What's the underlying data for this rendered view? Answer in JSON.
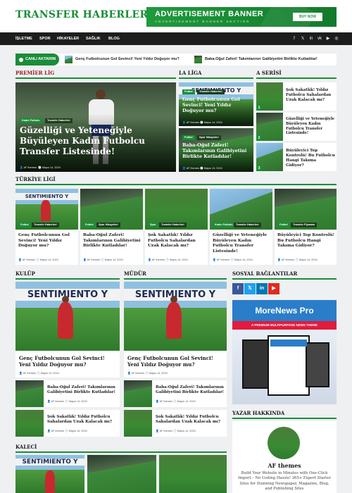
{
  "header": {
    "logo": "TRANSFER HABERLERİ",
    "ad_title": "ADVERTISEMENT BANNER",
    "ad_subtitle": "ADVERTISEMENT BANNER SECTION",
    "ad_button": "BUY NOW"
  },
  "nav": {
    "items": [
      "İŞLETME",
      "SPOR",
      "HİKAYELER",
      "SAĞLIK",
      "BLOG"
    ],
    "social_icons": [
      "facebook-icon",
      "x-icon",
      "linkedin-icon",
      "vk-icon",
      "youtube-icon",
      "instagram-icon"
    ],
    "social_glyphs": [
      "f",
      "𝕏",
      "in",
      "vk",
      "▶",
      "◎"
    ]
  },
  "ticker": {
    "label": "CANLI AKTARIM",
    "items": [
      "Genç Futbolcunun Gol Sevinci! Yeni Yıldız Doğuyor mu?",
      "Baba-Oğul Zaferi! Takımlarının Galibiyetini Birlikte Kutladılar!"
    ]
  },
  "sections": {
    "premier": "PREMİER LİG",
    "laliga": "LA LİGA",
    "serie": "A SERİSİ",
    "turkiye": "TÜRKİYE LİGİ",
    "kulup": "KULÜP",
    "mudur": "MÜDÜR",
    "sosyal": "SOSYAL BAĞLANTILAR",
    "yazar": "YAZAR HAKKINDA",
    "kaleci": "KALECİ"
  },
  "premier": {
    "tags": [
      "Kadın Futbolu",
      "Transfer Haberleri"
    ],
    "title": "Güzelliği ve Yeteneğiyle Büyüleyen Kadın Futbolcu Transfer Listesinde!",
    "author": "AF themes",
    "date": "Mayıs 14, 2024"
  },
  "laliga": [
    {
      "tags": [
        "Futbol",
        "Transfer Haberleri"
      ],
      "title": "Genç Futbolcunun Gol Sevinci! Yeni Yıldız Doğuyor mu?",
      "author": "AF themes",
      "date": "Mayıs 14, 2024"
    },
    {
      "tags": [
        "Futbol",
        "Spor Hikayeleri"
      ],
      "title": "Baba-Oğul Zaferi! Takımlarının Galibiyetini Birlikte Kutladılar!",
      "author": "AF themes",
      "date": "Mayıs 14, 2024"
    }
  ],
  "serie": [
    {
      "num": "1",
      "title": "Şok Sakatlık! Yıldız Futbolcu Sahalardan Uzak Kalacak mı?"
    },
    {
      "num": "2",
      "title": "Güzelliği ve Yeteneğiyle Büyüleyen Kadın Futbolcu Transfer Listesinde!"
    },
    {
      "num": "3",
      "title": "Büyüleyici Top Kontrolü! Bu Futbolcu Hangi Takıma Gidiyor?"
    }
  ],
  "turkiye": [
    {
      "tags": [
        "Futbol",
        "Transfer Haberleri"
      ],
      "title": "Genç Futbolcunun Gol Sevinci! Yeni Yıldız Doğuyor mu?",
      "author": "AF themes",
      "date": "Mayıs 14, 2024"
    },
    {
      "tags": [
        "Futbol",
        "Spor Hikayeleri"
      ],
      "title": "Baba-Oğul Zaferi! Takımlarının Galibiyetini Birlikte Kutladılar!",
      "author": "AF themes",
      "date": "Mayıs 14, 2024"
    },
    {
      "tags": [
        "Spor",
        "Transfer Haberleri"
      ],
      "title": "Şok Sakatlık! Yıldız Futbolcu Sahalardan Uzak Kalacak mı?",
      "author": "AF themes",
      "date": "Mayıs 14, 2024"
    },
    {
      "tags": [
        "Kadın Futbolu",
        "Transfer Haberleri"
      ],
      "title": "Güzelliği ve Yeteneğiyle Büyüleyen Kadın Futbolcu Transfer Listesinde!",
      "author": "AF themes",
      "date": "Mayıs 14, 2024"
    },
    {
      "tags": [
        "Futbol",
        "Transfer Piyasası"
      ],
      "title": "Büyüleyici Top Kontrolü! Bu Futbolcu Hangi Takıma Gidiyor?",
      "author": "AF themes",
      "date": "Mayıs 14, 2024"
    }
  ],
  "kulup": {
    "main_title": "Genç Futbolcunun Gol Sevinci! Yeni Yıldız Doğuyor mu?",
    "main_author": "AF themes",
    "main_date": "Mayıs 14, 2024",
    "list": [
      {
        "title": "Baba-Oğul Zaferi! Takımlarının Galibiyetini Birlikte Kutladılar!",
        "author": "AF themes",
        "date": "Mayıs 14, 2024"
      },
      {
        "title": "Şok Sakatlık! Yıldız Futbolcu Sahalardan Uzak Kalacak mı?",
        "author": "AF themes",
        "date": "Mayıs 14, 2024"
      }
    ]
  },
  "mudur": {
    "main_title": "Genç Futbolcunun Gol Sevinci! Yeni Yıldız Doğuyor mu?",
    "main_author": "AF themes",
    "main_date": "Mayıs 14, 2024",
    "list": [
      {
        "title": "Baba-Oğul Zaferi! Takımlarının Galibiyetini Birlikte Kutladılar!",
        "author": "AF themes",
        "date": "Mayıs 14, 2024"
      },
      {
        "title": "Şok Sakatlık! Yıldız Futbolcu Sahalardan Uzak Kalacak mı?",
        "author": "AF themes",
        "date": "Mayıs 14, 2024"
      }
    ]
  },
  "social_buttons": [
    {
      "icon": "facebook-icon",
      "glyph": "f",
      "color": "#3b5998"
    },
    {
      "icon": "x-icon",
      "glyph": "𝕏",
      "color": "#1da1f2"
    },
    {
      "icon": "linkedin-icon",
      "glyph": "in",
      "color": "#0077b5"
    },
    {
      "icon": "youtube-icon",
      "glyph": "▶",
      "color": "#e02a20"
    }
  ],
  "promo": {
    "title": "MoreNews Pro",
    "subtitle": "A PREMIUM MULTIPURPOSE NEWS THEME"
  },
  "author_box": {
    "name": "AF themes",
    "bio": "Build Your Website in Minutes with One-Click Import – No Coding Hassle! 365+ Expert Starter Sites for Stunning Newspaper, Magazine, Blog, and Publishing Sites"
  },
  "banner_text": "SENTIMIENTO Y",
  "colors": {
    "accent": "#1a8d38",
    "dark": "#1d1d1d",
    "section_red": "#9b1b24"
  }
}
